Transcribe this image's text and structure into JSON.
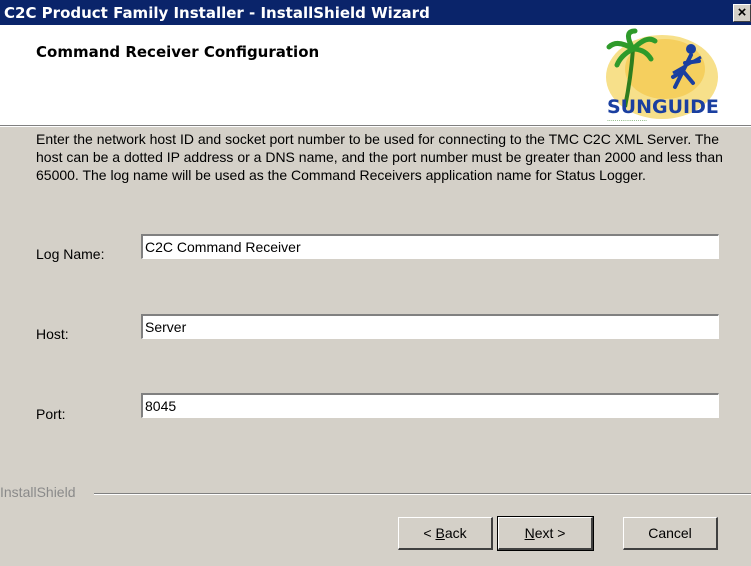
{
  "window": {
    "title": "C2C Product Family Installer - InstallShield Wizard",
    "close_glyph": "×"
  },
  "header": {
    "title": "Command Receiver Configuration",
    "logo_text": "SUNGUIDE",
    "logo_icon": "palm-tree-runner-logo"
  },
  "description": "Enter the network host ID and socket port number to be used for connecting to the TMC C2C XML Server.  The host can be a dotted IP address or a DNS name, and the port number must be greater than 2000 and less than 65000. The log name will be used as the Command Receivers application name for Status Logger.",
  "form": {
    "log_name": {
      "label": "Log Name:",
      "value": "C2C Command Receiver"
    },
    "host": {
      "label": "Host:",
      "value": "Server"
    },
    "port": {
      "label": "Port:",
      "value": "8045"
    }
  },
  "footer": {
    "brand": "InstallShield",
    "back": {
      "prefix": "< ",
      "accel": "B",
      "rest": "ack"
    },
    "next": {
      "accel": "N",
      "rest": "ext >"
    },
    "cancel": "Cancel"
  },
  "colors": {
    "titlebar": "#0a246a",
    "dialog": "#d4d0c8",
    "header": "#ffffff"
  }
}
